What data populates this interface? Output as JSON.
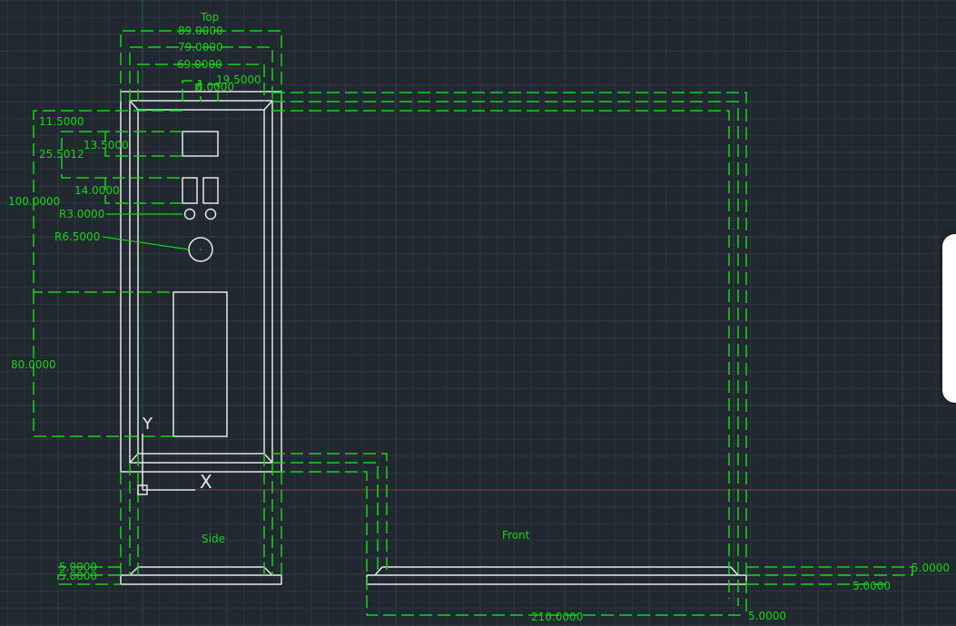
{
  "colors": {
    "background": "#212830",
    "grid": "#2d3540",
    "grid_major": "#323c47",
    "outline": "#e6e6e6",
    "dimension": "#19d219",
    "axis_x": "#8a3a3a",
    "axis_y": "#2e5a3a"
  },
  "view_labels": {
    "top": "Top",
    "side": "Side",
    "front": "Front"
  },
  "ucs": {
    "x_label": "X",
    "y_label": "Y"
  },
  "dimensions": {
    "d89": "89.0000",
    "d79": "79.0000",
    "d69": "69.0000",
    "d19_5": "19.5000",
    "d8": "8.0000",
    "d11_5": "11.5000",
    "d13_5": "13.5000",
    "d25_5012": "25.5012",
    "d14": "14.0000",
    "d100": "100.0000",
    "r3": "R3.0000",
    "r6_5": "R6.5000",
    "d80": "80.0000",
    "d5_left_a": "5.0000",
    "d5_left_b": "5.0000",
    "d5_right_a": "5.0000",
    "d5_right_b": "5.0000",
    "d210": "210.0000",
    "d5_bottom": "5.0000"
  },
  "side_panel": {
    "state": "collapsed"
  }
}
